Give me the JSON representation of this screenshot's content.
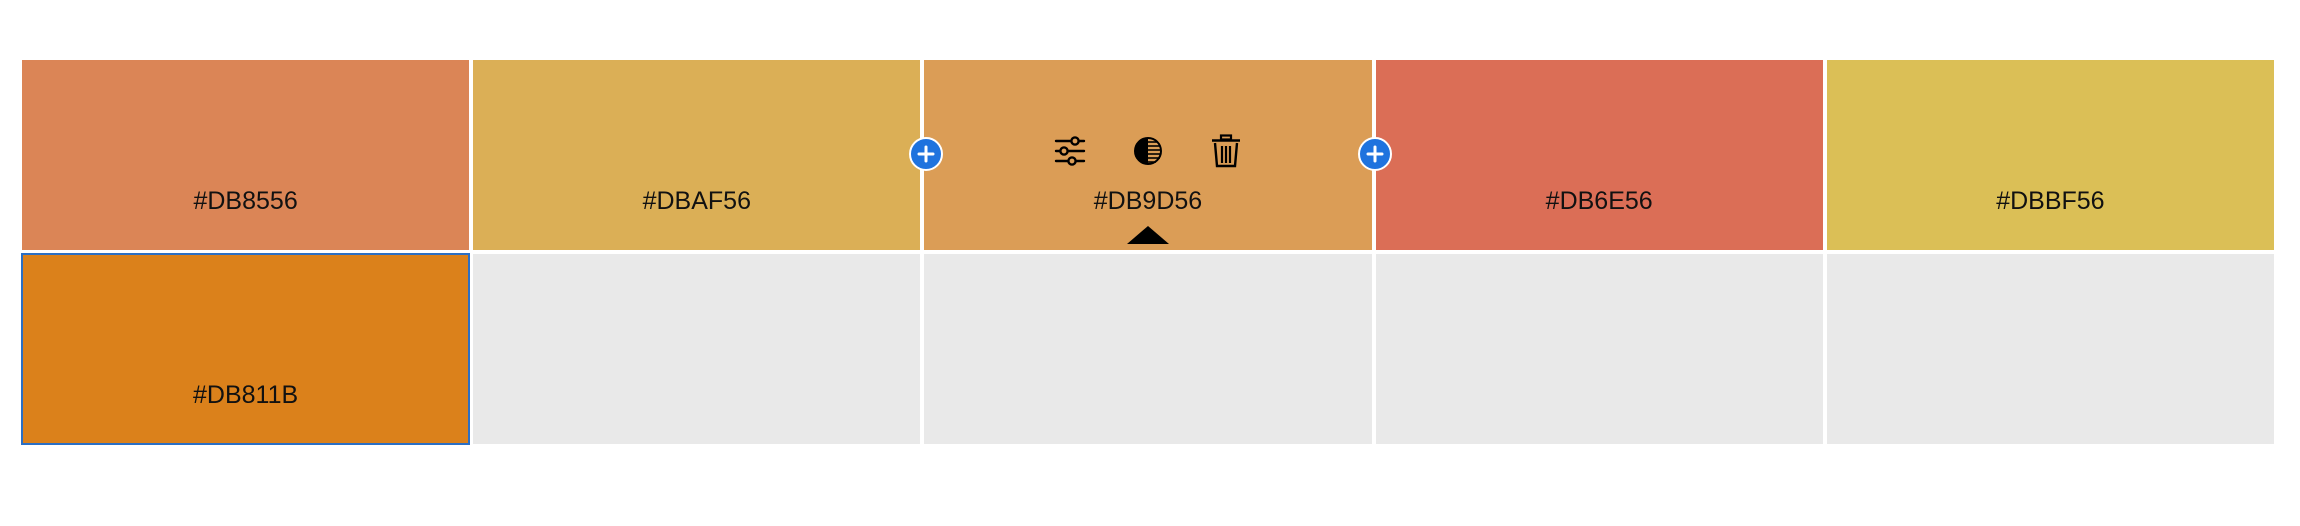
{
  "palette": {
    "swatches": [
      {
        "hex": "#DB8556",
        "color": "#DB8556"
      },
      {
        "hex": "#DBAF56",
        "color": "#DBAF56"
      },
      {
        "hex": "#DB9D56",
        "color": "#DB9D56"
      },
      {
        "hex": "#DB6E56",
        "color": "#DB6E56"
      },
      {
        "hex": "#DBBF56",
        "color": "#DBBF56"
      },
      {
        "hex": "#DB811B",
        "color": "#DB811B"
      }
    ],
    "empty_slot_color": "#E9E9E9",
    "selected_outline_color": "#2B6FC4"
  },
  "toolbar": {
    "icons": [
      "sliders-icon",
      "contrast-icon",
      "trash-icon"
    ]
  },
  "add_button": {
    "color": "#1F73DE",
    "icon": "plus-icon"
  }
}
